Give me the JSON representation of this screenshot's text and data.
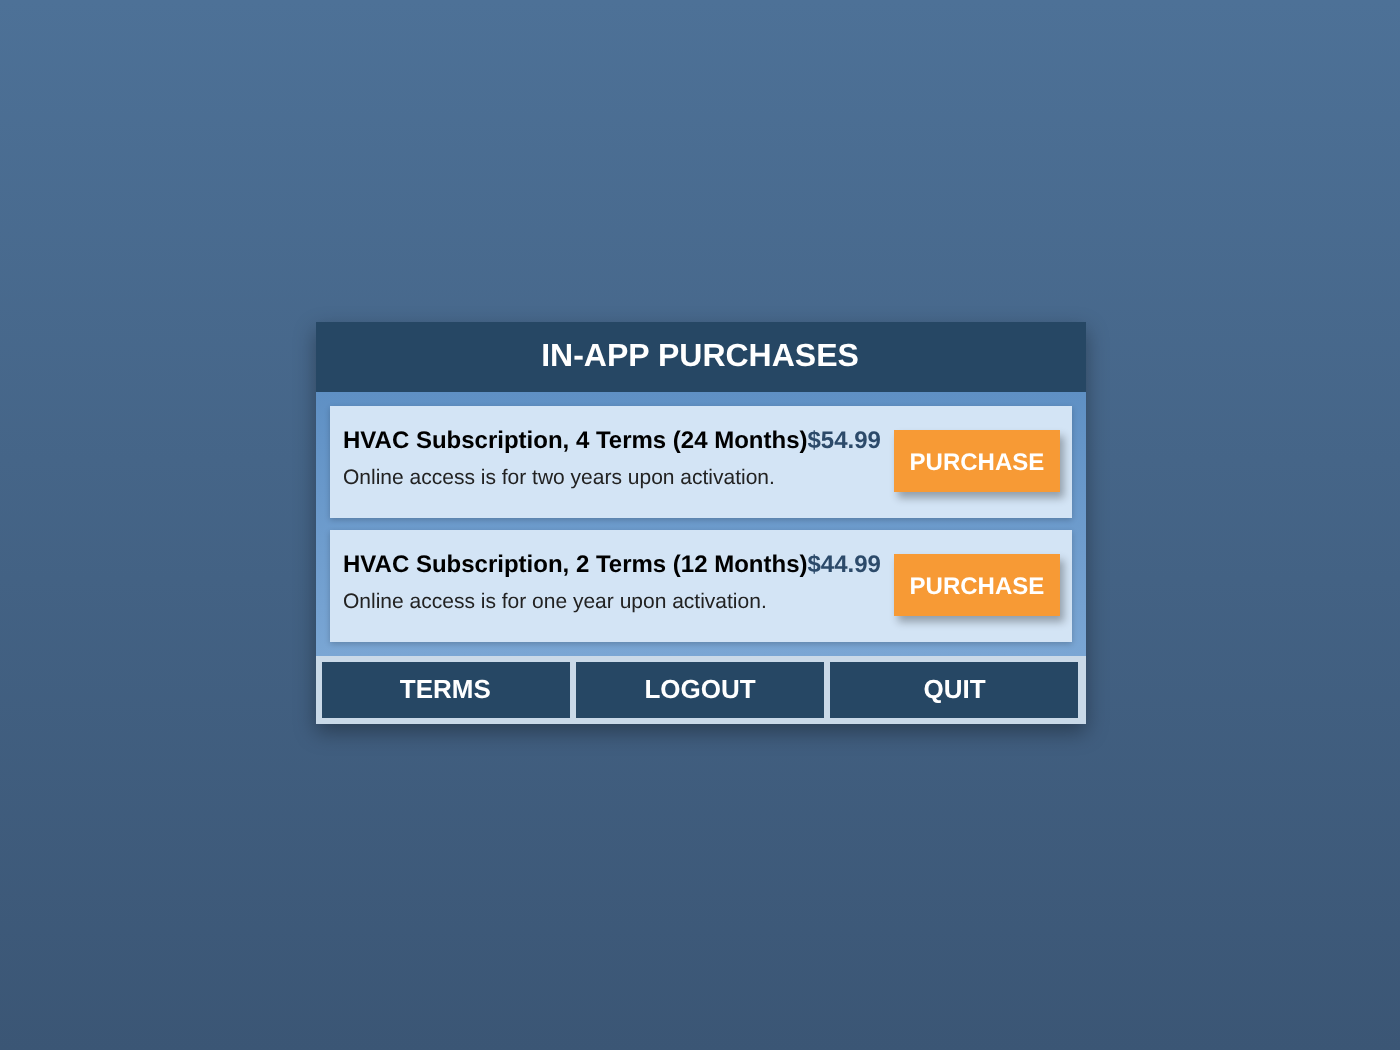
{
  "dialog": {
    "title": "IN-APP PURCHASES"
  },
  "products": [
    {
      "name": "HVAC Subscription, 4 Terms (24 Months)",
      "description": "Online access is for two years upon activation.",
      "price": "$54.99",
      "button": "PURCHASE"
    },
    {
      "name": "HVAC Subscription, 2 Terms (12 Months)",
      "description": "Online access is for one year upon activation.",
      "price": "$44.99",
      "button": "PURCHASE"
    }
  ],
  "buttons": [
    "TERMS",
    "LOGOUT",
    "QUIT"
  ]
}
